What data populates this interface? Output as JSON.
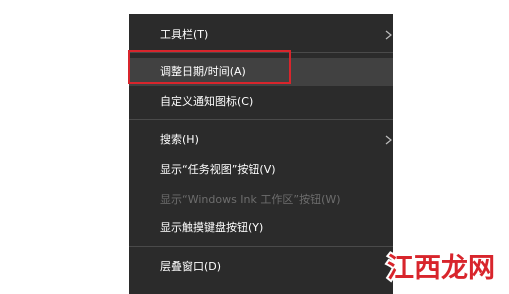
{
  "menu": {
    "items": [
      {
        "label": "工具栏(T)",
        "submenu": true
      },
      {
        "label": "调整日期/时间(A)",
        "highlighted": true
      },
      {
        "label": "自定义通知图标(C)"
      },
      {
        "label": "搜索(H)",
        "submenu": true
      },
      {
        "label": "显示“任务视图”按钮(V)"
      },
      {
        "label": "显示“Windows Ink 工作区”按钮(W)",
        "disabled": true
      },
      {
        "label": "显示触摸键盘按钮(Y)"
      },
      {
        "label": "层叠窗口(D)"
      }
    ]
  },
  "annotation": {
    "color": "#d8252c"
  },
  "watermark": {
    "text": "江西龙网",
    "color": "#d8252c"
  },
  "colors": {
    "menu_bg": "#2b2b2b",
    "menu_text": "#ffffff",
    "disabled_text": "#6d6d6d",
    "separator": "#4a4a4a"
  }
}
